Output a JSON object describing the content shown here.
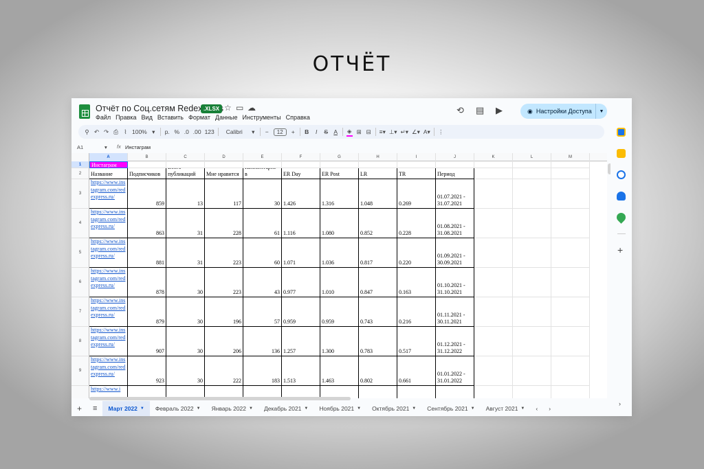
{
  "heading": "ОТЧЁТ",
  "doc": {
    "title": "Отчёт по Соц.сетям Redexpress",
    "badge": ".XLSX",
    "menu": [
      "Файл",
      "Правка",
      "Вид",
      "Вставить",
      "Формат",
      "Данные",
      "Инструменты",
      "Справка"
    ],
    "share_label": "Настройки Доступа",
    "avatar": "1"
  },
  "toolbar": {
    "zoom": "100%",
    "currency": "р.",
    "percent": "%",
    "dec_less": ".0",
    "dec_more": ".00",
    "num_fmt": "123",
    "font": "Calibri",
    "font_size": "12"
  },
  "formula_bar": {
    "cell_ref": "A1",
    "fx": "fx",
    "value": "Инстаграм"
  },
  "columns": [
    "A",
    "B",
    "C",
    "D",
    "E",
    "F",
    "G",
    "H",
    "I",
    "J",
    "K",
    "L",
    "M"
  ],
  "a1": "Инстаграм",
  "headers": [
    "Название",
    "Подписчиков",
    "Всего публикаций",
    "Мне нравится",
    "Комментарие в",
    "ER Day",
    "ER Post",
    "LR",
    "TR",
    "Период"
  ],
  "rows": [
    {
      "n": "3",
      "url": "https://www.instagram.com/redexpress.ru/",
      "subs": "859",
      "posts": "13",
      "likes": "117",
      "comments": "30",
      "er_day": "1.426",
      "er_post": "1.316",
      "lr": "1.048",
      "tr": "0.269",
      "period": "01.07.2021 - 31.07.2021"
    },
    {
      "n": "4",
      "url": "https://www.instagram.com/redexpress.ru/",
      "subs": "863",
      "posts": "31",
      "likes": "228",
      "comments": "61",
      "er_day": "1.116",
      "er_post": "1.080",
      "lr": "0.852",
      "tr": "0.228",
      "period": "01.08.2021 - 31.08.2021"
    },
    {
      "n": "5",
      "url": "https://www.instagram.com/redexpress.ru/",
      "subs": "881",
      "posts": "31",
      "likes": "223",
      "comments": "60",
      "er_day": "1.071",
      "er_post": "1.036",
      "lr": "0.817",
      "tr": "0.220",
      "period": "01.09.2021 - 30.09.2021"
    },
    {
      "n": "6",
      "url": "https://www.instagram.com/redexpress.ru/",
      "subs": "878",
      "posts": "30",
      "likes": "223",
      "comments": "43",
      "er_day": "0.977",
      "er_post": "1.010",
      "lr": "0.847",
      "tr": "0.163",
      "period": "01.10.2021 - 31.10.2021"
    },
    {
      "n": "7",
      "url": "https://www.instagram.com/redexpress.ru/",
      "subs": "879",
      "posts": "30",
      "likes": "196",
      "comments": "57",
      "er_day": "0.959",
      "er_post": "0.959",
      "lr": "0.743",
      "tr": "0.216",
      "period": "01.11.2021 - 30.11.2021"
    },
    {
      "n": "8",
      "url": "https://www.instagram.com/redexpress.ru/",
      "subs": "907",
      "posts": "30",
      "likes": "206",
      "comments": "136",
      "er_day": "1.257",
      "er_post": "1.300",
      "lr": "0.783",
      "tr": "0.517",
      "period": "01.12.2021 - 31.12.2022"
    },
    {
      "n": "9",
      "url": "https://www.instagram.com/redexpress.ru/",
      "subs": "923",
      "posts": "30",
      "likes": "222",
      "comments": "183",
      "er_day": "1.513",
      "er_post": "1.463",
      "lr": "0.802",
      "tr": "0.661",
      "period": "01.01.2022 - 31.01.2022"
    }
  ],
  "partial_row_url": "https://www.i",
  "row_numbers": [
    "1",
    "2"
  ],
  "sheet_tabs": [
    "Март 2022",
    "Февраль 2022",
    "Январь 2022",
    "Декабрь 2021",
    "Ноябрь 2021",
    "Октябрь 2021",
    "Сентябрь 2021",
    "Август 2021"
  ],
  "colors": {
    "accent": "#0b57d0",
    "highlight": "#ff00ff",
    "share": "#c2e7ff",
    "sheets_green": "#1e8e3e"
  }
}
